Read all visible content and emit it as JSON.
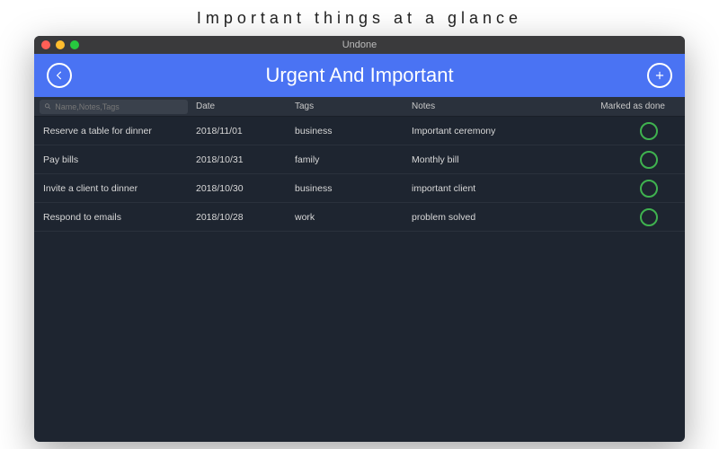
{
  "caption": "Important things at a glance",
  "window": {
    "title": "Undone"
  },
  "header": {
    "title": "Urgent And Important"
  },
  "search": {
    "placeholder": "Name,Notes,Tags"
  },
  "columns": {
    "date": "Date",
    "tags": "Tags",
    "notes": "Notes",
    "done": "Marked as done"
  },
  "rows": [
    {
      "name": "Reserve a table for dinner",
      "date": "2018/11/01",
      "tags": "business",
      "notes": "Important ceremony"
    },
    {
      "name": "Pay bills",
      "date": "2018/10/31",
      "tags": "family",
      "notes": "Monthly bill"
    },
    {
      "name": "Invite a client to dinner",
      "date": "2018/10/30",
      "tags": "business",
      "notes": "important client"
    },
    {
      "name": "Respond to emails",
      "date": "2018/10/28",
      "tags": "work",
      "notes": "problem solved"
    }
  ]
}
